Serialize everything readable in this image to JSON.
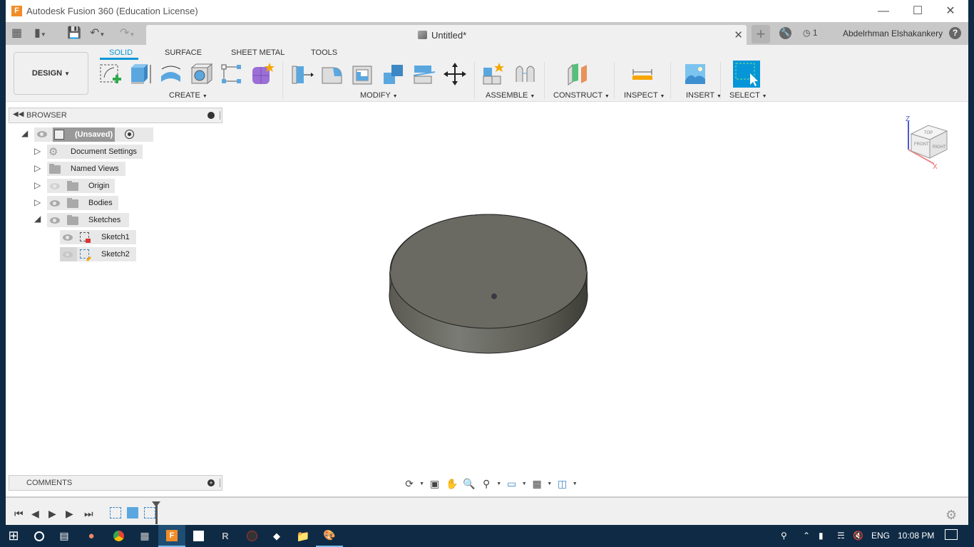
{
  "window": {
    "title": "Autodesk Fusion 360 (Education License)",
    "controls": [
      "minimize",
      "maximize",
      "close"
    ]
  },
  "appbar": {
    "document_tab": "Untitled*",
    "jobs_count": "1",
    "user_name": "Abdelrhman Elshakankery",
    "help_label": "?"
  },
  "ribbon": {
    "workspace": "DESIGN",
    "tabs": [
      {
        "label": "SOLID",
        "active": true
      },
      {
        "label": "SURFACE",
        "active": false
      },
      {
        "label": "SHEET METAL",
        "active": false
      },
      {
        "label": "TOOLS",
        "active": false
      }
    ],
    "groups": [
      {
        "label": "CREATE",
        "tools": [
          "create-sketch",
          "extrude",
          "revolve",
          "hole",
          "pattern",
          "create-form"
        ]
      },
      {
        "label": "MODIFY",
        "tools": [
          "press-pull",
          "fillet",
          "shell",
          "combine",
          "split-body",
          "move-copy"
        ]
      },
      {
        "label": "ASSEMBLE",
        "tools": [
          "new-component",
          "joint"
        ]
      },
      {
        "label": "CONSTRUCT",
        "tools": [
          "offset-plane"
        ]
      },
      {
        "label": "INSPECT",
        "tools": [
          "measure"
        ]
      },
      {
        "label": "INSERT",
        "tools": [
          "insert-image"
        ]
      },
      {
        "label": "SELECT",
        "tools": [
          "select"
        ]
      }
    ]
  },
  "browser": {
    "title": "BROWSER",
    "root": "(Unsaved)",
    "items": [
      {
        "label": "Document Settings",
        "icon": "gear-icon",
        "expanded": false,
        "visible": null
      },
      {
        "label": "Named Views",
        "icon": "folder-icon",
        "expanded": false,
        "visible": null
      },
      {
        "label": "Origin",
        "icon": "folder-icon",
        "expanded": false,
        "visible": false
      },
      {
        "label": "Bodies",
        "icon": "folder-icon",
        "expanded": false,
        "visible": true
      },
      {
        "label": "Sketches",
        "icon": "folder-icon",
        "expanded": true,
        "visible": true
      }
    ],
    "sketches": [
      {
        "label": "Sketch1",
        "visible": true
      },
      {
        "label": "Sketch2",
        "visible": false
      }
    ]
  },
  "viewcube": {
    "faces": [
      "TOP",
      "FRONT",
      "RIGHT"
    ],
    "axes": [
      "Z",
      "X"
    ]
  },
  "comments": {
    "title": "COMMENTS"
  },
  "timeline": {
    "features": [
      "sketch",
      "extrude",
      "sketch"
    ]
  },
  "taskbar": {
    "language": "ENG",
    "time": "10:08 PM"
  },
  "colors": {
    "accent": "#0696d7",
    "body": "#6b6a62",
    "taskbar": "#0f2a44"
  }
}
